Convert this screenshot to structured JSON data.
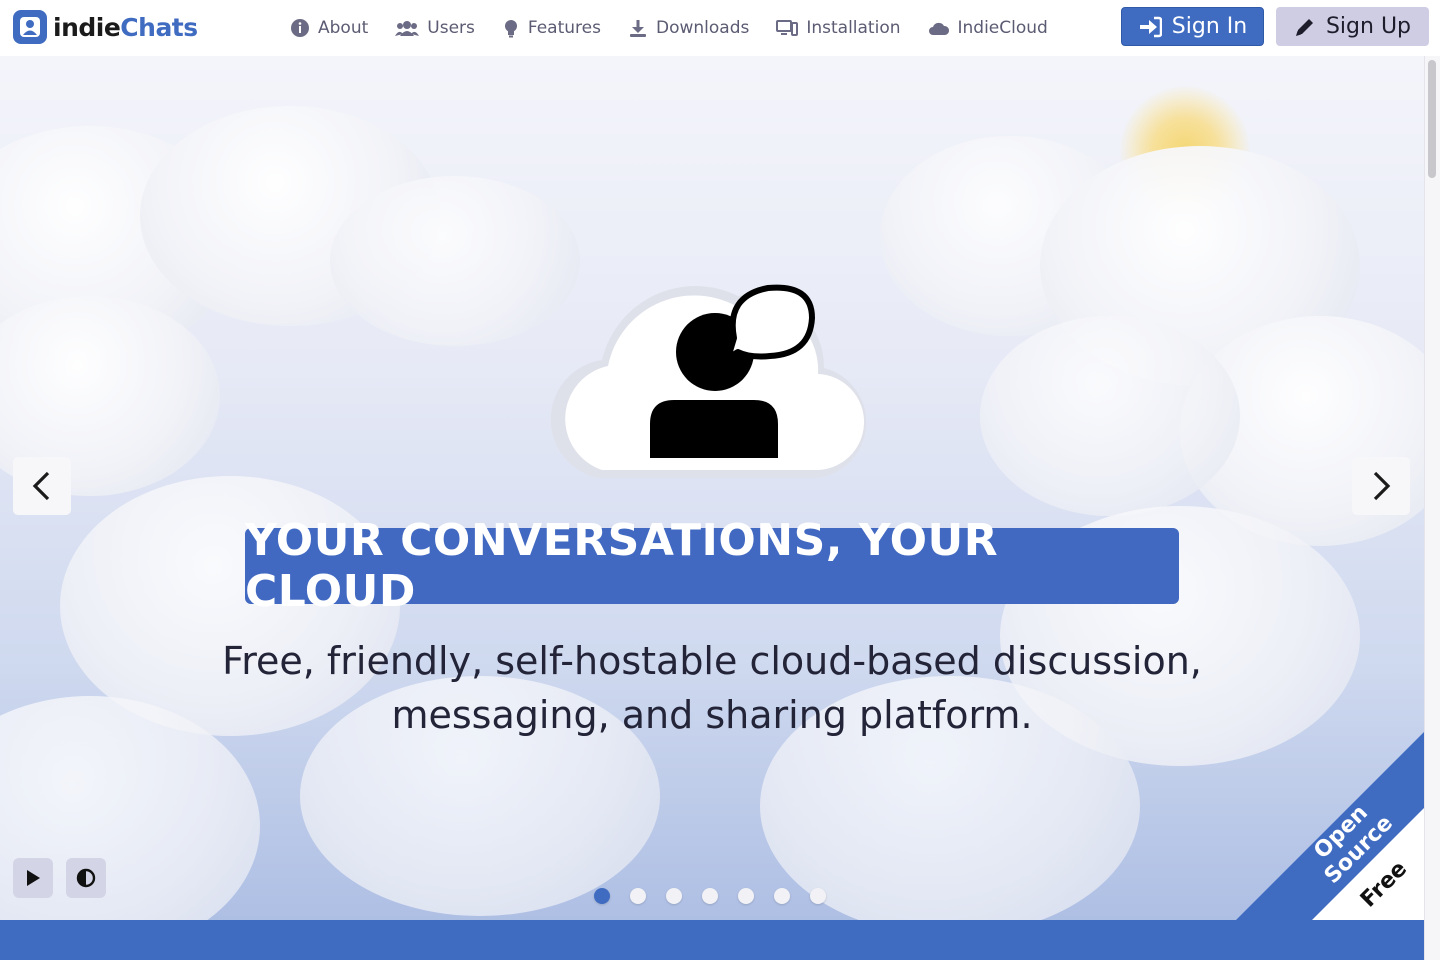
{
  "brand": {
    "name_part1": "indie",
    "name_part2": "Chats",
    "accent_color": "#3f6bc1"
  },
  "nav": {
    "items": [
      {
        "label": "About",
        "icon": "info-circle-icon"
      },
      {
        "label": "Users",
        "icon": "users-icon"
      },
      {
        "label": "Features",
        "icon": "lightbulb-icon"
      },
      {
        "label": "Downloads",
        "icon": "download-icon"
      },
      {
        "label": "Installation",
        "icon": "devices-icon"
      },
      {
        "label": "IndieCloud",
        "icon": "cloud-icon"
      }
    ]
  },
  "auth": {
    "signin_label": "Sign In",
    "signup_label": "Sign Up"
  },
  "hero": {
    "tagline": "YOUR CONVERSATIONS, YOUR CLOUD",
    "subtitle_line1": "Free, friendly, self-hostable cloud-based discussion,",
    "subtitle_line2": "messaging, and sharing platform.",
    "slide_count": 7,
    "active_slide": 1
  },
  "ribbon": {
    "line1": "Open Source",
    "line2": "Free"
  },
  "controls": {
    "play": "play-icon",
    "contrast": "contrast-icon"
  }
}
